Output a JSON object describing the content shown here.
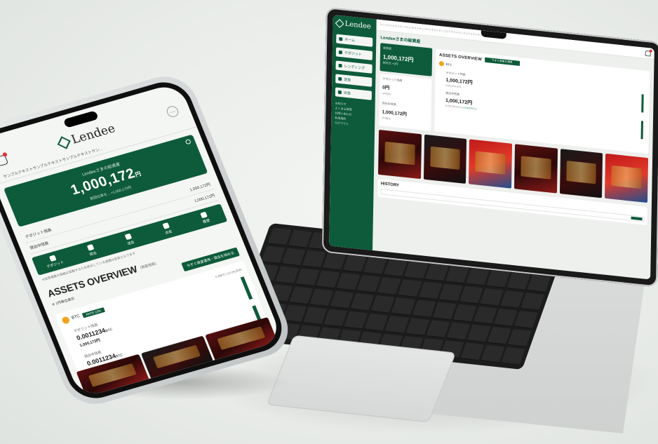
{
  "laptop": {
    "brand": "Lendee",
    "greeting": "Lendeeさまの総資産",
    "ticker": "サンプルテキストサンプルテキストサンプルテキストサンプルテキストサンプルテキストサンプルテキスト",
    "nav": [
      "ホーム",
      "デポジット",
      "レンディング",
      "送金",
      "出金"
    ],
    "side_links": [
      "お知らせ",
      "よくある質問",
      "お問い合わせ",
      "利用規約",
      "ログアウト"
    ],
    "total_label": "総資産",
    "total_value": "1,000,172円",
    "total_sub": "前日比 +0円",
    "small_cards": [
      {
        "label": "デポジット残高",
        "value": "0円",
        "sub": "0円相当"
      },
      {
        "label": "貸出中残高",
        "value": "1,000,172円",
        "sub": "0円相当"
      }
    ],
    "assets_title": "ASSETS OVERVIEW",
    "assets_button": "今すぐ資産を運用",
    "coin": "BTC",
    "stats": [
      {
        "label": "デポジット残高",
        "value": "1,000,172円",
        "sub": "0.001234 BTC",
        "extra": ""
      },
      {
        "label": "貸出中残高",
        "value": "1,000,172円",
        "sub": "0.001234 BTC",
        "extra": "(+0.000 BTC)"
      }
    ],
    "history_title": "HISTORY"
  },
  "phone": {
    "brand": "Lendee",
    "menu_icon": "⋯",
    "ticker": "サンプルテキストサンプルテキストサンプルテキストサン...",
    "total_label": "Lendeeさまの総資産",
    "total_value": "1,000,172",
    "total_unit": "円",
    "total_sub": "前回比率を... +1,000,172円",
    "rows": [
      {
        "label": "デポジット残高",
        "value": "1,000,172円"
      },
      {
        "label": "貸出中残高",
        "value": "1,000,172円"
      }
    ],
    "actions": [
      "デポジット",
      "貸出",
      "送金",
      "出金",
      "履歴"
    ],
    "note": "※仮想通貨の価格は変動するため表示している金額は目安となります",
    "overview_title": "ASSETS OVERVIEW",
    "overview_sub": "(資産残高)",
    "overview_left": "※ 1円単位表示",
    "overview_button": "今すぐ資産運用・貸出を始める",
    "coin": "BTC",
    "coin_tag": "RATE 10%",
    "coin_note": "5.38BTC (10.0%)年利",
    "stats": [
      {
        "label": "デポジット残高",
        "value": "0.0011234",
        "unit": "BTC",
        "sub": "1,000,172円",
        "extra": ""
      },
      {
        "label": "貸出中残高",
        "value": "0.0011234",
        "unit": "BTC",
        "sub": "1,000,172円",
        "extra": "+0.000 BTC"
      }
    ]
  }
}
